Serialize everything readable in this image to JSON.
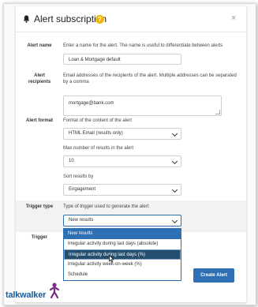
{
  "dialog": {
    "title": "Alert subscription",
    "help_glyph": "?",
    "close_glyph": "×"
  },
  "fields": {
    "alert_name": {
      "label": "Alert name",
      "description": "Enter a name for the alert. The name is useful to differentiate between alerts",
      "value": "Loan & Mortgage default"
    },
    "recipients": {
      "label_line1": "Alert",
      "label_line2": "recipients",
      "description": "Email addresses of the recipients of the alert. Multiple addresses can be separated by a comma",
      "value": "mortgage@bank.com"
    },
    "format": {
      "label": "Alert format",
      "description": "Format of the content of the alert",
      "value": "HTML Email (results only)",
      "max_label": "Max number of results in the alert",
      "max_value": "10",
      "sort_label": "Sort results by",
      "sort_value": "Engagement"
    },
    "trigger": {
      "label": "Trigger type",
      "description": "Type of trigger used to generate the alert",
      "value": "New results",
      "options": [
        "New results",
        "Irregular activity during last days (absolute)",
        "Irregular activity during last days (%)",
        "Irregular activity week-on-week (%)",
        "Schedule"
      ],
      "second_label": "Trigger"
    }
  },
  "actions": {
    "create": "Create Alert"
  },
  "brand": {
    "logo_text": "talkwalker",
    "accent": "#2f6fb3",
    "highlight": "#244e6e",
    "help_color": "#f0b400"
  },
  "icons": {
    "bell": "bell-icon",
    "help": "help-icon",
    "close": "close-icon",
    "chevron": "chevron-down-icon"
  }
}
